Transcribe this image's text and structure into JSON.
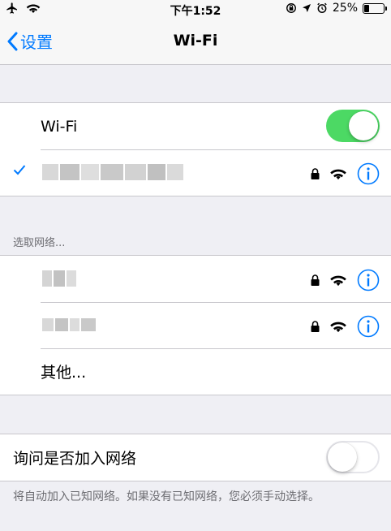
{
  "status": {
    "time": "下午1:52",
    "battery_percent": "25%",
    "battery_level": 0.25
  },
  "nav": {
    "back_label": "设置",
    "title": "Wi-Fi"
  },
  "wifi": {
    "label": "Wi-Fi",
    "enabled": true,
    "connected_network_hidden": true
  },
  "networks": {
    "header": "选取网络...",
    "other_label": "其他..."
  },
  "ask": {
    "label": "询问是否加入网络",
    "enabled": false,
    "footer": "将自动加入已知网络。如果没有已知网络，您必须手动选择。"
  },
  "colors": {
    "accent": "#007aff",
    "toggle_on": "#4cd964",
    "background": "#efeff4"
  }
}
